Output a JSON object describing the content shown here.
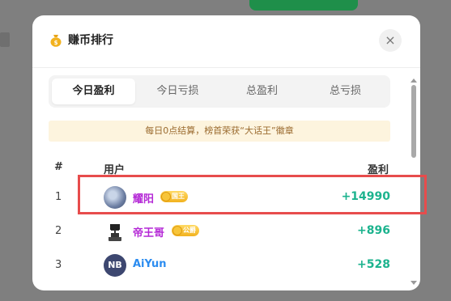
{
  "modal": {
    "title": "赚币排行",
    "title_icon": "money-bag-icon",
    "close_label": "×"
  },
  "tabs": [
    {
      "label": "今日盈利",
      "active": true
    },
    {
      "label": "今日亏损",
      "active": false
    },
    {
      "label": "总盈利",
      "active": false
    },
    {
      "label": "总亏损",
      "active": false
    }
  ],
  "notice": "每日0点结算，榜首荣获“大话王”徽章",
  "table": {
    "headers": {
      "rank": "#",
      "user": "用户",
      "profit": "盈利"
    },
    "rows": [
      {
        "rank": "1",
        "name": "耀阳",
        "name_color": "#b428d6",
        "badge": "国王",
        "profit": "+14990"
      },
      {
        "rank": "2",
        "name": "帝王哥",
        "name_color": "#b428d6",
        "badge": "公爵",
        "profit": "+896"
      },
      {
        "rank": "3",
        "name": "AiYun",
        "name_color": "#2b8cf0",
        "avatar_text": "NB",
        "profit": "+528"
      }
    ]
  },
  "colors": {
    "profit": "#1cb38e",
    "highlight": "#e74c4c",
    "notice_bg": "#fdf4de"
  }
}
